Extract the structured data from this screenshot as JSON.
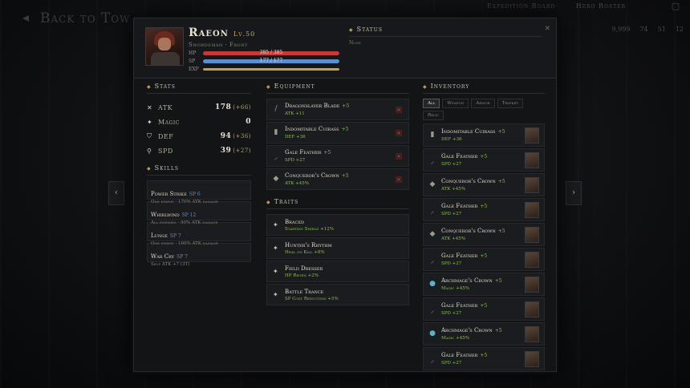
{
  "topbar": {
    "back_label": "Back to Town",
    "links": [
      "Expedition Board",
      "Hero Roster"
    ],
    "currency": [
      "9,999",
      "74",
      "51",
      "12"
    ]
  },
  "hero": {
    "name": "Raeon",
    "level": "Lv.50",
    "class_line": "Swordsman · Front",
    "hp_label": "HP",
    "hp_value": "385 / 385",
    "hp_fraction": 1.0,
    "sp_label": "SP",
    "sp_value": "177 / 177",
    "sp_fraction": 1.0,
    "exp_label": "EXP",
    "exp_fraction": 1.0
  },
  "status": {
    "title": "Status",
    "value": "None"
  },
  "stats": {
    "title": "Stats",
    "items": [
      {
        "icon": "crossed-swords-icon",
        "glyph": "✕",
        "name": "ATK",
        "value": "178",
        "bonus": "(+66)"
      },
      {
        "icon": "sparkle-icon",
        "glyph": "✦",
        "name": "Magic",
        "value": "0",
        "bonus": ""
      },
      {
        "icon": "shield-icon",
        "glyph": "⛉",
        "name": "DEF",
        "value": "94",
        "bonus": "(+36)"
      },
      {
        "icon": "boot-icon",
        "glyph": "⚲",
        "name": "SPD",
        "value": "39",
        "bonus": "(+27)"
      }
    ]
  },
  "skills": {
    "title": "Skills",
    "items": [
      {
        "name": "Power Strike",
        "sp": "SP 6",
        "desc": "One enemy · 170% ATK damage"
      },
      {
        "name": "Whirlwind",
        "sp": "SP 12",
        "desc": "All enemies · 90% ATK damage"
      },
      {
        "name": "Lunge",
        "sp": "SP 7",
        "desc": "One enemy · 160% ATK damage"
      },
      {
        "name": "War Cry",
        "sp": "SP 7",
        "desc": "Self ATK +7 (3T)"
      }
    ]
  },
  "equipment": {
    "title": "Equipment",
    "items": [
      {
        "name": "Dragonslayer Blade",
        "plus": "+5",
        "stat": "ATK +11",
        "icon": "sword-icon",
        "glyph": "/"
      },
      {
        "name": "Indomitable Cuirass",
        "plus": "+5",
        "stat": "DEF +36",
        "icon": "armor-icon",
        "glyph": "▮"
      },
      {
        "name": "Gale Feather",
        "plus": "+5",
        "stat": "SPD +27",
        "icon": "feather-icon",
        "glyph": "⸝"
      },
      {
        "name": "Conqueror's Crown",
        "plus": "+5",
        "stat": "ATK +45%",
        "icon": "crystal-icon",
        "glyph": "◆"
      }
    ]
  },
  "traits": {
    "title": "Traits",
    "items": [
      {
        "name": "Braced",
        "desc": "Starting Shield +12%"
      },
      {
        "name": "Hunter's Rhythm",
        "desc": "Heal on Kill +8%"
      },
      {
        "name": "Field Dresser",
        "desc": "HP Regen +2%"
      },
      {
        "name": "Battle Trance",
        "desc": "SP Cost Reduction +5%"
      }
    ]
  },
  "inventory": {
    "title": "Inventory",
    "tabs": [
      "All",
      "Weapon",
      "Armor",
      "Trinket",
      "Relic"
    ],
    "items": [
      {
        "name": "Indomitable Cuirass",
        "plus": "+5",
        "stat": "DEF +36",
        "icon": "armor-icon",
        "glyph": "▮"
      },
      {
        "name": "Gale Feather",
        "plus": "+5",
        "stat": "SPD +27",
        "icon": "feather-icon",
        "glyph": "⸝"
      },
      {
        "name": "Conqueror's Crown",
        "plus": "+5",
        "stat": "ATK +45%",
        "icon": "crystal-icon",
        "glyph": "◆"
      },
      {
        "name": "Gale Feather",
        "plus": "+5",
        "stat": "SPD +27",
        "icon": "feather-icon",
        "glyph": "⸝"
      },
      {
        "name": "Conqueror's Crown",
        "plus": "+5",
        "stat": "ATK +45%",
        "icon": "crystal-icon",
        "glyph": "◆"
      },
      {
        "name": "Gale Feather",
        "plus": "+5",
        "stat": "SPD +27",
        "icon": "feather-icon",
        "glyph": "⸝"
      },
      {
        "name": "Archmage's Crown",
        "plus": "+5",
        "stat": "Magic +45%",
        "icon": "orb-icon",
        "glyph": "●"
      },
      {
        "name": "Gale Feather",
        "plus": "+5",
        "stat": "SPD +27",
        "icon": "feather-icon",
        "glyph": "⸝"
      },
      {
        "name": "Archmage's Crown",
        "plus": "+5",
        "stat": "Magic +45%",
        "icon": "orb-icon",
        "glyph": "●"
      },
      {
        "name": "Gale Feather",
        "plus": "+5",
        "stat": "SPD +27",
        "icon": "feather-icon",
        "glyph": "⸝"
      }
    ]
  },
  "colors": {
    "hp": "#c73a3a",
    "sp": "#5c8fd1",
    "exp": "#c9a43e",
    "bonus_green": "#8fbf56",
    "accent_gold": "#b89a52"
  }
}
